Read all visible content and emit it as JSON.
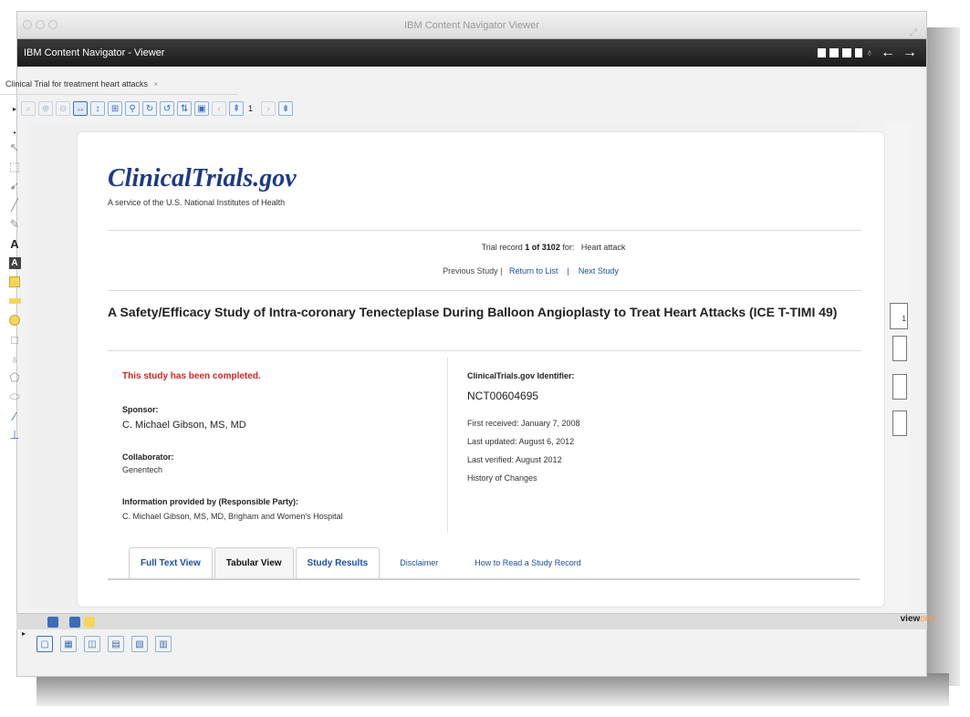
{
  "window": {
    "title": "IBM Content Navigator Viewer"
  },
  "app": {
    "title": "IBM Content Navigator - Viewer"
  },
  "doc_tab": {
    "label": "Clinical Trial for treatment heart attacks",
    "close": "×"
  },
  "toolbar": {
    "page_number": "1"
  },
  "page": {
    "logo": "ClinicalTrials.gov",
    "subtitle": "A service of the U.S. National Institutes of Health",
    "trial_record": {
      "prefix": "Trial record ",
      "position": "1 of 3102",
      "for": " for:",
      "query": "Heart attack"
    },
    "nav": {
      "previous": "Previous Study |",
      "return": "Return to List",
      "sep": "|",
      "next": "Next Study"
    },
    "title": "A Safety/Efficacy Study of Intra-coronary Tenecteplase During Balloon Angioplasty to Treat Heart Attacks (ICE T-TIMI 49)",
    "status": "This study has been completed.",
    "sponsor_label": "Sponsor:",
    "sponsor": "C. Michael Gibson, MS, MD",
    "collaborator_label": "Collaborator:",
    "collaborator": "Genentech",
    "info_label": "Information provided by (Responsible Party):",
    "info": "C. Michael Gibson, MS, MD, Brigham and Women's Hospital",
    "identifier_label": "ClinicalTrials.gov Identifier:",
    "identifier": "NCT00604695",
    "first_received": "First received: January 7, 2008",
    "last_updated": "Last updated: August 6, 2012",
    "last_verified": "Last verified: August 2012",
    "history": "History of Changes",
    "tabs": [
      "Full Text View",
      "Tabular View",
      "Study Results"
    ],
    "disclaimer": "Disclaimer",
    "how_to": "How to Read a Study Record"
  },
  "brand": {
    "view": "view",
    "one": "one"
  },
  "colors": {
    "link": "#1d4fa0",
    "alert": "#d62424",
    "logo": "#1d3a86",
    "appbar": "#1c1c1c"
  }
}
